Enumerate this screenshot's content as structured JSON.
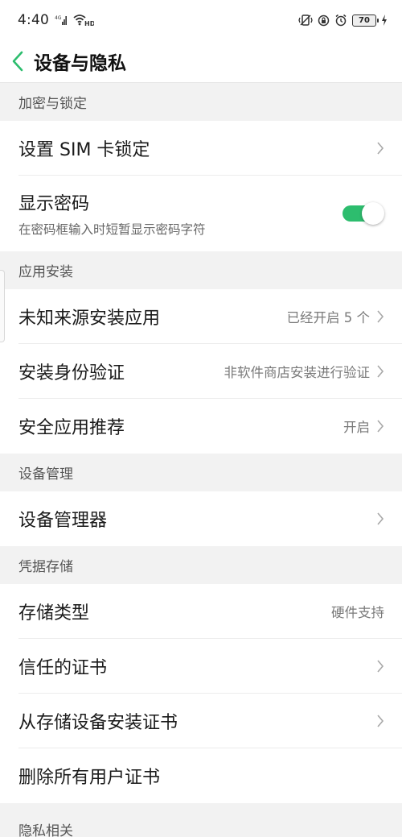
{
  "status_bar": {
    "time": "4:40",
    "network": "4G",
    "wifi_label": "HD",
    "battery": "70"
  },
  "header": {
    "title": "设备与隐私"
  },
  "colors": {
    "accent": "#2dbd6e",
    "section_bg": "#f2f2f2"
  },
  "sections": {
    "encryption": {
      "title": "加密与锁定",
      "sim_lock": {
        "label": "设置 SIM 卡锁定"
      },
      "show_password": {
        "label": "显示密码",
        "sub": "在密码框输入时短暂显示密码字符",
        "enabled": true
      }
    },
    "app_install": {
      "title": "应用安装",
      "unknown_sources": {
        "label": "未知来源安装应用",
        "value": "已经开启 5 个"
      },
      "install_verify": {
        "label": "安装身份验证",
        "value": "非软件商店安装进行验证"
      },
      "security_recommend": {
        "label": "安全应用推荐",
        "value": "开启"
      }
    },
    "device_management": {
      "title": "设备管理",
      "device_admin": {
        "label": "设备管理器"
      }
    },
    "credential_storage": {
      "title": "凭据存储",
      "storage_type": {
        "label": "存储类型",
        "value": "硬件支持"
      },
      "trusted_certs": {
        "label": "信任的证书"
      },
      "install_from_storage": {
        "label": "从存储设备安装证书"
      },
      "clear_certs": {
        "label": "删除所有用户证书"
      }
    },
    "privacy": {
      "title": "隐私相关"
    }
  }
}
